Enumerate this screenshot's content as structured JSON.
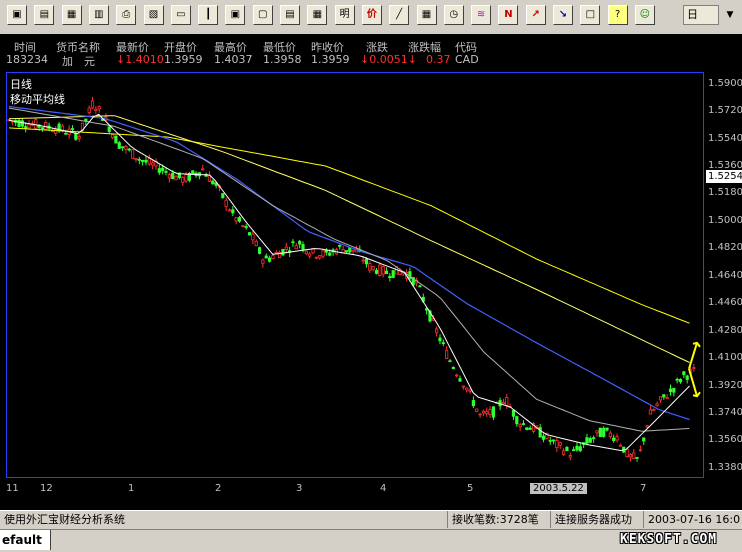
{
  "toolbar": {
    "buttons": [
      {
        "name": "open-icon",
        "glyph": "▣"
      },
      {
        "name": "stock-list-icon",
        "glyph": "▤"
      },
      {
        "name": "close-window-icon",
        "glyph": "▦"
      },
      {
        "name": "window-icon",
        "glyph": "▥"
      },
      {
        "name": "print-icon",
        "glyph": "⎙"
      },
      {
        "name": "print-preview-icon",
        "glyph": "▧"
      },
      {
        "name": "minute-chart-icon",
        "glyph": "▭"
      },
      {
        "name": "candlestick-icon",
        "glyph": "┃"
      },
      {
        "name": "chart-window-icon",
        "glyph": "▣"
      },
      {
        "name": "tile-window-icon",
        "glyph": "▢"
      },
      {
        "name": "formula-icon",
        "glyph": "▤"
      },
      {
        "name": "compute-icon",
        "glyph": "▦"
      },
      {
        "name": "info-icon",
        "glyph": "明"
      },
      {
        "name": "price-icon",
        "glyph": "价"
      },
      {
        "name": "draw-line-icon",
        "glyph": "╱"
      },
      {
        "name": "grid-icon",
        "glyph": "▦"
      },
      {
        "name": "clock-icon",
        "glyph": "◷"
      },
      {
        "name": "chart-switch-icon",
        "glyph": "≋"
      },
      {
        "name": "news-icon",
        "glyph": "N"
      },
      {
        "name": "up-arrow-icon",
        "glyph": "↗"
      },
      {
        "name": "down-arrow-icon",
        "glyph": "↘"
      },
      {
        "name": "box-icon",
        "glyph": "□"
      },
      {
        "name": "help-icon",
        "glyph": "?"
      },
      {
        "name": "emoji-icon",
        "glyph": "☺"
      }
    ],
    "period_select": "日"
  },
  "quote": {
    "headers": [
      "时间",
      "货币名称",
      "最新价",
      "开盘价",
      "最高价",
      "最低价",
      "昨收价",
      "涨跌",
      "涨跌幅",
      "代码"
    ],
    "values": [
      "183234",
      "加　元",
      "↓1.4010",
      "1.3959",
      "1.4037",
      "1.3958",
      "1.3959",
      "↓0.0051↓",
      "0.37",
      "CAD"
    ]
  },
  "legend": {
    "title": "日线",
    "subtitle": "移动平均线"
  },
  "status": {
    "left": "使用外汇宝财经分析系统",
    "count": "接收笔数:3728笔",
    "server": "连接服务器成功",
    "time": "2003-07-16 16:0"
  },
  "bottom": {
    "tab": "efault",
    "watermark": "KEKSOFT.COM"
  },
  "colors": {
    "up": "#ff3030",
    "down": "#30ff30",
    "ma_short": "#ffffff",
    "ma_mid": "#ffff60",
    "ma_blue": "#4060ff",
    "ma_gray": "#b0b0b0",
    "ma_long": "#ffff00",
    "border": "#2a3cff"
  },
  "chart_data": {
    "type": "candlestick",
    "currency": "CAD",
    "y_ticks": [
      "1.5900",
      "1.5720",
      "1.5540",
      "1.5360",
      "1.5180",
      "1.5000",
      "1.4820",
      "1.4640",
      "1.4460",
      "1.4280",
      "1.4100",
      "1.3920",
      "1.3740",
      "1.3560",
      "1.3380"
    ],
    "y_tick_values": [
      1.59,
      1.572,
      1.554,
      1.536,
      1.518,
      1.5,
      1.482,
      1.464,
      1.446,
      1.428,
      1.41,
      1.392,
      1.374,
      1.356,
      1.338
    ],
    "y_current_marker": "1.5254",
    "ylim": [
      1.332,
      1.597
    ],
    "x_labels": [
      "11",
      "12",
      "1",
      "2",
      "3",
      "4",
      "5",
      "2003.5.22",
      "6",
      "7"
    ],
    "close_path": [
      {
        "t": 0,
        "v": 1.566
      },
      {
        "t": 20,
        "v": 1.562
      },
      {
        "t": 30,
        "v": 1.56
      },
      {
        "t": 40,
        "v": 1.556
      },
      {
        "t": 48,
        "v": 1.578
      },
      {
        "t": 55,
        "v": 1.566
      },
      {
        "t": 62,
        "v": 1.551
      },
      {
        "t": 75,
        "v": 1.54
      },
      {
        "t": 85,
        "v": 1.535
      },
      {
        "t": 95,
        "v": 1.529
      },
      {
        "t": 100,
        "v": 1.527
      },
      {
        "t": 110,
        "v": 1.534
      },
      {
        "t": 118,
        "v": 1.523
      },
      {
        "t": 128,
        "v": 1.503
      },
      {
        "t": 138,
        "v": 1.49
      },
      {
        "t": 145,
        "v": 1.474
      },
      {
        "t": 155,
        "v": 1.48
      },
      {
        "t": 165,
        "v": 1.486
      },
      {
        "t": 172,
        "v": 1.479
      },
      {
        "t": 180,
        "v": 1.478
      },
      {
        "t": 188,
        "v": 1.482
      },
      {
        "t": 198,
        "v": 1.48
      },
      {
        "t": 205,
        "v": 1.47
      },
      {
        "t": 215,
        "v": 1.466
      },
      {
        "t": 225,
        "v": 1.467
      },
      {
        "t": 232,
        "v": 1.459
      },
      {
        "t": 240,
        "v": 1.436
      },
      {
        "t": 250,
        "v": 1.41
      },
      {
        "t": 260,
        "v": 1.391
      },
      {
        "t": 268,
        "v": 1.372
      },
      {
        "t": 275,
        "v": 1.374
      },
      {
        "t": 282,
        "v": 1.384
      },
      {
        "t": 290,
        "v": 1.368
      },
      {
        "t": 300,
        "v": 1.363
      },
      {
        "t": 310,
        "v": 1.354
      },
      {
        "t": 320,
        "v": 1.347
      },
      {
        "t": 330,
        "v": 1.356
      },
      {
        "t": 338,
        "v": 1.362
      },
      {
        "t": 346,
        "v": 1.358
      },
      {
        "t": 352,
        "v": 1.346
      },
      {
        "t": 358,
        "v": 1.343
      },
      {
        "t": 364,
        "v": 1.372
      },
      {
        "t": 370,
        "v": 1.381
      },
      {
        "t": 377,
        "v": 1.389
      },
      {
        "t": 383,
        "v": 1.398
      },
      {
        "t": 389,
        "v": 1.401
      }
    ],
    "ma_long": [
      {
        "t": 0,
        "v": 1.561
      },
      {
        "t": 90,
        "v": 1.555
      },
      {
        "t": 180,
        "v": 1.536
      },
      {
        "t": 240,
        "v": 1.51
      },
      {
        "t": 300,
        "v": 1.475
      },
      {
        "t": 360,
        "v": 1.445
      },
      {
        "t": 389,
        "v": 1.432
      }
    ],
    "ma_mid": [
      {
        "t": 0,
        "v": 1.567
      },
      {
        "t": 60,
        "v": 1.569
      },
      {
        "t": 120,
        "v": 1.546
      },
      {
        "t": 180,
        "v": 1.52
      },
      {
        "t": 240,
        "v": 1.487
      },
      {
        "t": 300,
        "v": 1.455
      },
      {
        "t": 389,
        "v": 1.406
      }
    ],
    "ma_blue": [
      {
        "t": 0,
        "v": 1.575
      },
      {
        "t": 55,
        "v": 1.567
      },
      {
        "t": 95,
        "v": 1.552
      },
      {
        "t": 130,
        "v": 1.527
      },
      {
        "t": 170,
        "v": 1.493
      },
      {
        "t": 200,
        "v": 1.48
      },
      {
        "t": 230,
        "v": 1.47
      },
      {
        "t": 260,
        "v": 1.446
      },
      {
        "t": 300,
        "v": 1.42
      },
      {
        "t": 340,
        "v": 1.395
      },
      {
        "t": 370,
        "v": 1.376
      },
      {
        "t": 389,
        "v": 1.369
      }
    ],
    "ma_gray": [
      {
        "t": 0,
        "v": 1.574
      },
      {
        "t": 60,
        "v": 1.562
      },
      {
        "t": 110,
        "v": 1.541
      },
      {
        "t": 150,
        "v": 1.51
      },
      {
        "t": 185,
        "v": 1.488
      },
      {
        "t": 215,
        "v": 1.474
      },
      {
        "t": 245,
        "v": 1.45
      },
      {
        "t": 270,
        "v": 1.414
      },
      {
        "t": 300,
        "v": 1.383
      },
      {
        "t": 330,
        "v": 1.369
      },
      {
        "t": 360,
        "v": 1.362
      },
      {
        "t": 389,
        "v": 1.364
      }
    ],
    "ma_short": [
      {
        "t": 0,
        "v": 1.566
      },
      {
        "t": 20,
        "v": 1.562
      },
      {
        "t": 40,
        "v": 1.557
      },
      {
        "t": 50,
        "v": 1.571
      },
      {
        "t": 70,
        "v": 1.548
      },
      {
        "t": 95,
        "v": 1.531
      },
      {
        "t": 115,
        "v": 1.53
      },
      {
        "t": 135,
        "v": 1.499
      },
      {
        "t": 150,
        "v": 1.478
      },
      {
        "t": 175,
        "v": 1.482
      },
      {
        "t": 200,
        "v": 1.477
      },
      {
        "t": 225,
        "v": 1.466
      },
      {
        "t": 245,
        "v": 1.43
      },
      {
        "t": 265,
        "v": 1.385
      },
      {
        "t": 285,
        "v": 1.378
      },
      {
        "t": 305,
        "v": 1.36
      },
      {
        "t": 330,
        "v": 1.353
      },
      {
        "t": 350,
        "v": 1.349
      },
      {
        "t": 365,
        "v": 1.366
      },
      {
        "t": 389,
        "v": 1.394
      }
    ],
    "n_bars": 390
  }
}
